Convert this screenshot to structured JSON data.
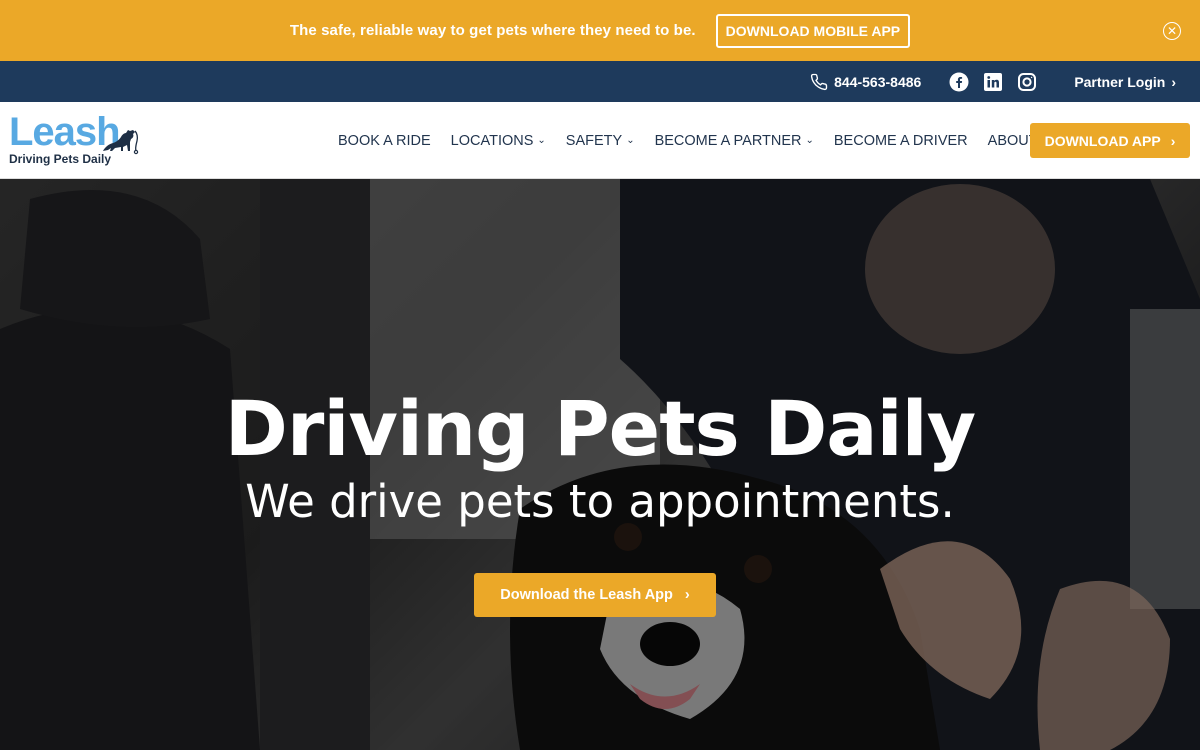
{
  "announcement": {
    "text": "The safe, reliable way to get pets where they need to be.",
    "button_label": "DOWNLOAD MOBILE APP",
    "close_icon": "close-circle-icon",
    "bg_color": "#eba828"
  },
  "utility": {
    "phone_icon": "phone-icon",
    "phone": "844-563-8486",
    "social": [
      "facebook-icon",
      "linkedin-icon",
      "instagram-icon"
    ],
    "partner_login": "Partner Login",
    "bg_color": "#1e3a5c"
  },
  "brand": {
    "name": "Leash",
    "tagline": "Driving Pets Daily"
  },
  "nav": {
    "items": [
      {
        "label": "BOOK A RIDE",
        "dropdown": false
      },
      {
        "label": "LOCATIONS",
        "dropdown": true
      },
      {
        "label": "SAFETY",
        "dropdown": true
      },
      {
        "label": "BECOME A PARTNER",
        "dropdown": true
      },
      {
        "label": "BECOME A DRIVER",
        "dropdown": false
      },
      {
        "label": "ABOUT",
        "dropdown": true
      }
    ],
    "cta_label": "DOWNLOAD APP"
  },
  "hero": {
    "title": "Driving Pets Daily",
    "subtitle": "We drive pets to appointments.",
    "button_label": "Download the Leash App",
    "accent_color": "#eba828"
  }
}
